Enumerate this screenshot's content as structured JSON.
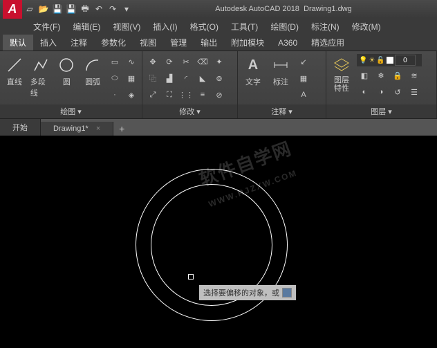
{
  "title": {
    "app": "Autodesk AutoCAD 2018",
    "file": "Drawing1.dwg"
  },
  "menu": {
    "file": "文件(F)",
    "edit": "编辑(E)",
    "view": "视图(V)",
    "insert": "插入(I)",
    "format": "格式(O)",
    "tools": "工具(T)",
    "draw": "绘图(D)",
    "dimension": "标注(N)",
    "modify": "修改(M)"
  },
  "rtabs": {
    "default": "默认",
    "insert": "插入",
    "annotate": "注释",
    "param": "参数化",
    "view": "视图",
    "manage": "管理",
    "output": "输出",
    "addins": "附加模块",
    "a360": "A360",
    "featured": "精选应用"
  },
  "panel": {
    "draw": "绘图",
    "modify": "修改",
    "annotate": "注释",
    "layer": "图层"
  },
  "tool": {
    "line": "直线",
    "polyline": "多段线",
    "circle": "圆",
    "arc": "圆弧",
    "text": "文字",
    "dim": "标注",
    "layerprop": "图层\n特性"
  },
  "tabs": {
    "start": "开始",
    "drawing": "Drawing1*"
  },
  "tooltip": {
    "text": "选择要偏移的对象，或"
  },
  "layer_val": "0"
}
